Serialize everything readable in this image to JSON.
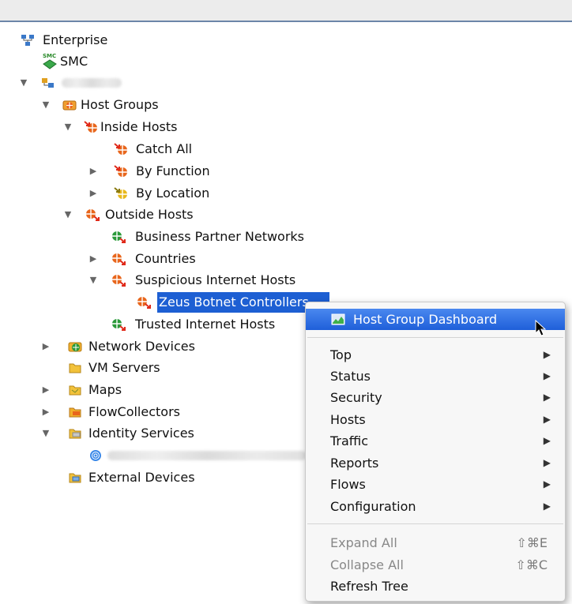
{
  "tree": {
    "enterprise": "Enterprise",
    "smc": "SMC",
    "smc_badge": "SMC",
    "domain_name": "",
    "host_groups": "Host Groups",
    "inside_hosts": "Inside Hosts",
    "catch_all": "Catch All",
    "by_function": "By Function",
    "by_location": "By Location",
    "outside_hosts": "Outside Hosts",
    "business_partner_networks": "Business Partner Networks",
    "countries": "Countries",
    "suspicious_internet_hosts": "Suspicious Internet Hosts",
    "zeus_botnet_controllers": "Zeus Botnet Controllers",
    "trusted_internet_hosts": "Trusted Internet Hosts",
    "network_devices": "Network Devices",
    "vm_servers": "VM Servers",
    "maps": "Maps",
    "flowcollectors": "FlowCollectors",
    "identity_services": "Identity Services",
    "identity_device_name": "",
    "external_devices": "External Devices"
  },
  "context_menu": {
    "dashboard": "Host Group Dashboard",
    "top": "Top",
    "status": "Status",
    "security": "Security",
    "hosts": "Hosts",
    "traffic": "Traffic",
    "reports": "Reports",
    "flows": "Flows",
    "configuration": "Configuration",
    "expand_all": "Expand All",
    "expand_all_shortcut": "⇧⌘E",
    "collapse_all": "Collapse All",
    "collapse_all_shortcut": "⇧⌘C",
    "refresh_tree": "Refresh Tree",
    "submenu_arrow": "▶"
  },
  "colors": {
    "selection": "#1d5fd3",
    "menu_highlight": "#2f6fe0",
    "inside_icon": "#e8661c",
    "outside_icon": "#e8661c",
    "trusted_icon": "#2a9a3a"
  }
}
